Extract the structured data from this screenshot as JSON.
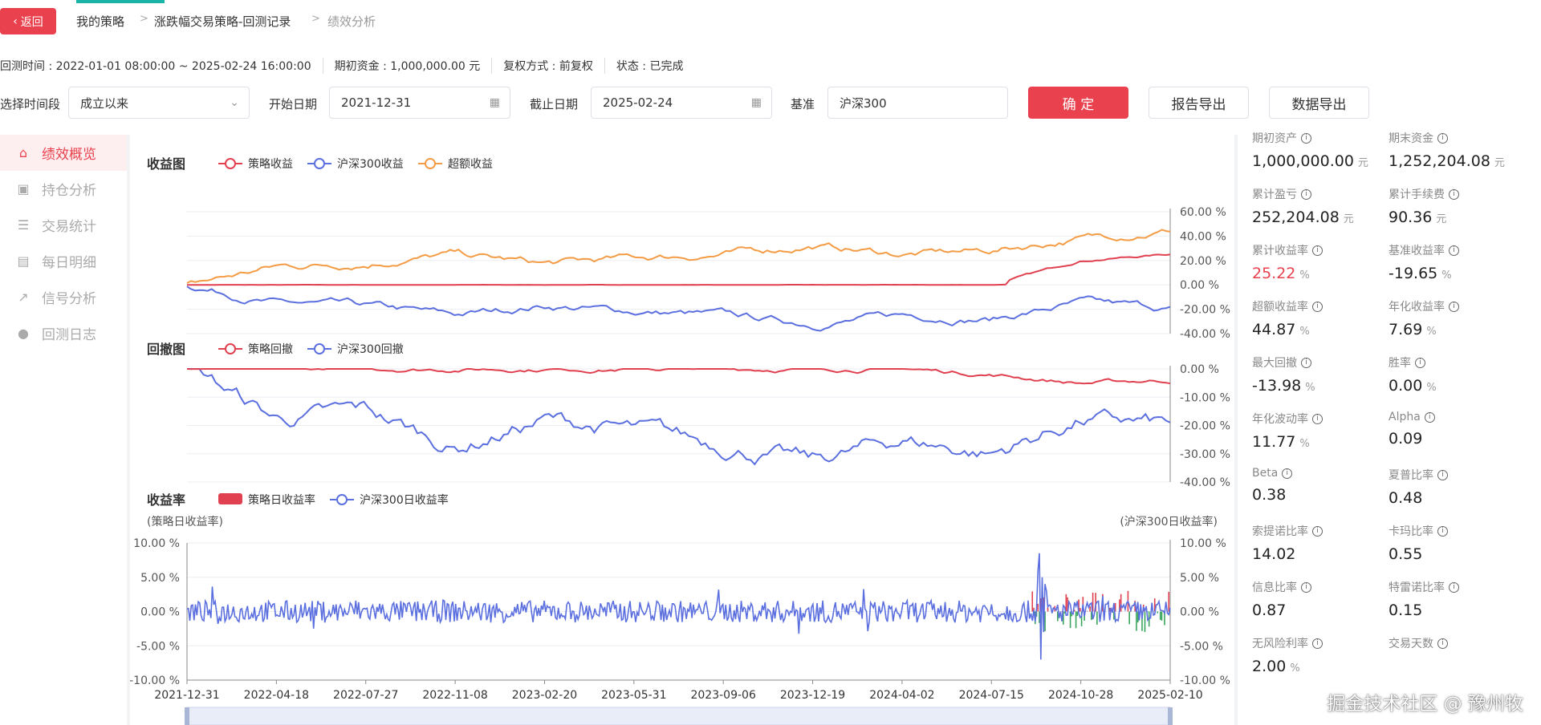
{
  "nav": {
    "back_label": "返回",
    "crumbs": [
      "我的策略",
      "涨跌幅交易策略-回测记录",
      "绩效分析"
    ]
  },
  "info": {
    "period": "回测时间 : 2022-01-01 08:00:00 ~ 2025-02-24 16:00:00",
    "capital": "期初资金 : 1,000,000.00 元",
    "adjust": "复权方式 : 前复权",
    "status": "状态 : 已完成"
  },
  "filters": {
    "range_label": "选择时间段",
    "range_value": "成立以来",
    "start_label": "开始日期",
    "start_value": "2021-12-31",
    "end_label": "截止日期",
    "end_value": "2025-02-24",
    "bench_label": "基准",
    "bench_value": "沪深300",
    "confirm": "确 定",
    "report_export": "报告导出",
    "data_export": "数据导出"
  },
  "sidebar": {
    "items": [
      {
        "label": "绩效概览",
        "icon": "home-icon"
      },
      {
        "label": "持仓分析",
        "icon": "position-icon"
      },
      {
        "label": "交易统计",
        "icon": "list-icon"
      },
      {
        "label": "每日明细",
        "icon": "detail-icon"
      },
      {
        "label": "信号分析",
        "icon": "trend-icon"
      },
      {
        "label": "回测日志",
        "icon": "info-icon"
      }
    ]
  },
  "colors": {
    "accent": "#e9424e",
    "strategy": "#e0404f",
    "bench": "#5b6fdf",
    "excess": "#f39c45",
    "teal": "#1ab5a8"
  },
  "chart_data": [
    {
      "type": "line",
      "title": "收益图",
      "legend": [
        "策略收益",
        "沪深300收益",
        "超额收益"
      ],
      "x": [
        "2021-12-31",
        "2022-04-18",
        "2022-07-27",
        "2022-11-08",
        "2023-02-20",
        "2023-05-31",
        "2023-09-06",
        "2023-12-19",
        "2024-04-02",
        "2024-07-15",
        "2024-10-28",
        "2025-02-10"
      ],
      "ylim": [
        -40,
        60
      ],
      "yticks": [
        "60.00 %",
        "40.00 %",
        "20.00 %",
        "0.00 %",
        "-20.00 %",
        "-40.00 %"
      ],
      "series": [
        {
          "name": "策略收益",
          "values": [
            0,
            0,
            0,
            0,
            0,
            0,
            0,
            0,
            0,
            0,
            20,
            25.22
          ]
        },
        {
          "name": "沪深300收益",
          "values": [
            0,
            -15,
            -18,
            -25,
            -17,
            -22,
            -25,
            -32,
            -25,
            -28,
            -15,
            -19.65
          ]
        },
        {
          "name": "超额收益",
          "values": [
            0,
            15,
            18,
            25,
            17,
            22,
            25,
            32,
            25,
            28,
            38,
            44.87
          ]
        }
      ]
    },
    {
      "type": "line",
      "title": "回撤图",
      "legend": [
        "策略回撤",
        "沪深300回撤"
      ],
      "ylim": [
        -40,
        0
      ],
      "yticks": [
        "0.00 %",
        "-10.00 %",
        "-20.00 %",
        "-30.00 %",
        "-40.00 %"
      ],
      "series": [
        {
          "name": "策略回撤",
          "values": [
            0,
            0,
            0,
            0,
            0,
            0,
            0,
            0,
            0,
            -2,
            -5,
            -4
          ]
        },
        {
          "name": "沪深300回撤",
          "values": [
            0,
            -18,
            -15,
            -28,
            -18,
            -22,
            -27,
            -33,
            -25,
            -30,
            -18,
            -20
          ]
        }
      ]
    },
    {
      "type": "bar",
      "title": "收益率",
      "legend": [
        "策略日收益率",
        "沪深300日收益率"
      ],
      "left_axis_label": "(策略日收益率)",
      "right_axis_label": "(沪深300日收益率)",
      "ylim": [
        -10,
        10
      ],
      "yticks": [
        "10.00 %",
        "5.00 %",
        "0.00 %",
        "-5.00 %",
        "-10.00 %"
      ]
    }
  ],
  "stats": [
    {
      "label": "期初资产",
      "value": "1,000,000.00",
      "unit": "元"
    },
    {
      "label": "期末资金",
      "value": "1,252,204.08",
      "unit": "元"
    },
    {
      "label": "累计盈亏",
      "value": "252,204.08",
      "unit": "元"
    },
    {
      "label": "累计手续费",
      "value": "90.36",
      "unit": "元"
    },
    {
      "label": "累计收益率",
      "value": "25.22",
      "unit": "%",
      "red": true
    },
    {
      "label": "基准收益率",
      "value": "-19.65",
      "unit": "%"
    },
    {
      "label": "超额收益率",
      "value": "44.87",
      "unit": "%"
    },
    {
      "label": "年化收益率",
      "value": "7.69",
      "unit": "%"
    },
    {
      "label": "最大回撤",
      "value": "-13.98",
      "unit": "%"
    },
    {
      "label": "胜率",
      "value": "0.00",
      "unit": "%"
    },
    {
      "label": "年化波动率",
      "value": "11.77",
      "unit": "%"
    },
    {
      "label": "Alpha",
      "value": "0.09",
      "unit": ""
    },
    {
      "label": "Beta",
      "value": "0.38",
      "unit": ""
    },
    {
      "label": "夏普比率",
      "value": "0.48",
      "unit": ""
    },
    {
      "label": "索提诺比率",
      "value": "14.02",
      "unit": ""
    },
    {
      "label": "卡玛比率",
      "value": "0.55",
      "unit": ""
    },
    {
      "label": "信息比率",
      "value": "0.87",
      "unit": ""
    },
    {
      "label": "特雷诺比率",
      "value": "0.15",
      "unit": ""
    },
    {
      "label": "无风险利率",
      "value": "2.00",
      "unit": "%"
    },
    {
      "label": "交易天数",
      "value": "",
      "unit": ""
    }
  ],
  "watermark": "掘金技术社区 @ 豫州牧"
}
